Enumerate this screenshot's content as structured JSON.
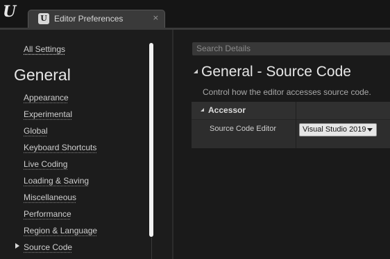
{
  "window": {
    "logo": "U",
    "tab_title": "Editor Preferences",
    "tab_icon": "unreal-editor-icon",
    "tab_close": "×"
  },
  "sidebar": {
    "all_settings": "All Settings",
    "heading": "General",
    "items": [
      {
        "label": "Appearance"
      },
      {
        "label": "Experimental"
      },
      {
        "label": "Global"
      },
      {
        "label": "Keyboard Shortcuts"
      },
      {
        "label": "Live Coding"
      },
      {
        "label": "Loading & Saving"
      },
      {
        "label": "Miscellaneous"
      },
      {
        "label": "Performance"
      },
      {
        "label": "Region & Language"
      },
      {
        "label": "Source Code",
        "selected": true
      }
    ]
  },
  "details": {
    "search_placeholder": "Search Details",
    "title": "General - Source Code",
    "description": "Control how the editor accesses source code.",
    "group": {
      "title": "Accessor",
      "property_label": "Source Code Editor",
      "property_value": "Visual Studio 2019"
    }
  },
  "colors": {
    "background": "#1a1a1a",
    "panel": "#2d2d2d",
    "accent_text": "#e6e6e6"
  }
}
